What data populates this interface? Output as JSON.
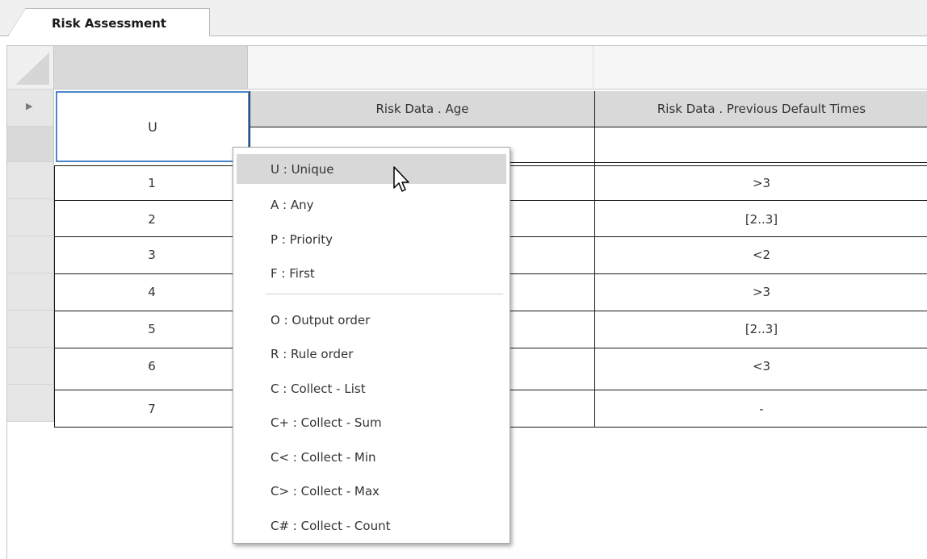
{
  "tab": {
    "label": "Risk Assessment"
  },
  "table": {
    "hit_policy": "U",
    "columns": [
      "Risk Data . Age",
      "Risk Data . Previous Default Times"
    ],
    "rows": [
      {
        "num": "1",
        "default_times": ">3"
      },
      {
        "num": "2",
        "default_times": "[2..3]"
      },
      {
        "num": "3",
        "default_times": "<2"
      },
      {
        "num": "4",
        "default_times": ">3"
      },
      {
        "num": "5",
        "default_times": "[2..3]"
      },
      {
        "num": "6",
        "default_times": "<3"
      },
      {
        "num": "7",
        "default_times": "-"
      }
    ]
  },
  "hit_policy_menu": {
    "items": [
      {
        "code": "U",
        "label": "U  : Unique",
        "highlighted": true
      },
      {
        "code": "A",
        "label": "A  : Any"
      },
      {
        "code": "P",
        "label": "P  : Priority"
      },
      {
        "code": "F",
        "label": "F  : First"
      },
      {
        "code": "O",
        "label": "O  : Output order"
      },
      {
        "code": "R",
        "label": "R  : Rule order"
      },
      {
        "code": "C",
        "label": "C  : Collect - List"
      },
      {
        "code": "C+",
        "label": "C+ : Collect - Sum"
      },
      {
        "code": "C<",
        "label": "C< : Collect - Min"
      },
      {
        "code": "C>",
        "label": "C> : Collect - Max"
      },
      {
        "code": "C#",
        "label": "C# : Collect - Count"
      }
    ]
  },
  "colors": {
    "menu_highlight": "#d8d8d8",
    "header_gray": "#d9d9d9",
    "selection_blue": "#4a86c8"
  }
}
